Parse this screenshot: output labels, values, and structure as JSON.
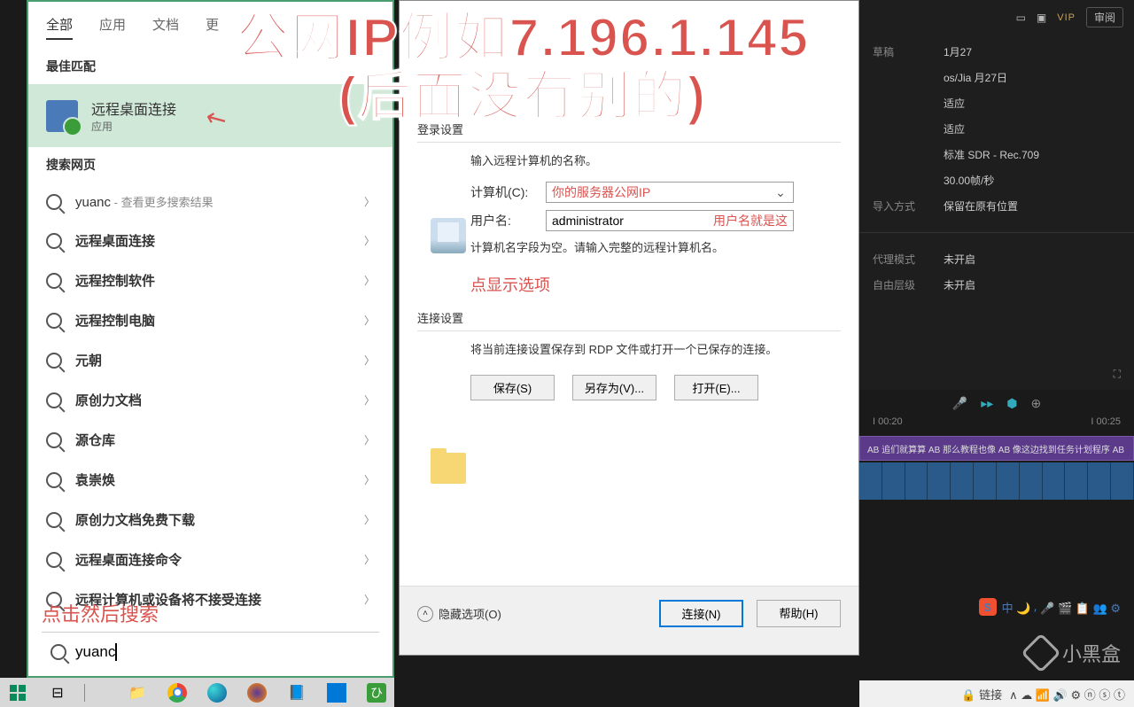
{
  "annotations": {
    "big": "公网IP例如7.196.1.145\n(后面没有别的)",
    "search_hint": "点击然后搜索",
    "arrow": "↖",
    "computer_field": "你的服务器公网IP",
    "username_note": "用户名就是这",
    "show_options": "点显示选项"
  },
  "search_panel": {
    "tabs": [
      "全部",
      "应用",
      "文档",
      "更"
    ],
    "best_match_header": "最佳匹配",
    "best_match": {
      "title": "远程桌面连接",
      "subtitle": "应用"
    },
    "web_header": "搜索网页",
    "items": [
      {
        "prefix": "yuanc",
        "suffix": " - 查看更多搜索结果",
        "bold": false
      },
      {
        "prefix": "远程桌面连接",
        "suffix": "",
        "bold": true
      },
      {
        "prefix": "远程控制软件",
        "suffix": "",
        "bold": true
      },
      {
        "prefix": "远程控制电脑",
        "suffix": "",
        "bold": true
      },
      {
        "prefix": "元朝",
        "suffix": "",
        "bold": true
      },
      {
        "prefix": "原创力文档",
        "suffix": "",
        "bold": true
      },
      {
        "prefix": "源仓库",
        "suffix": "",
        "bold": true
      },
      {
        "prefix": "袁崇焕",
        "suffix": "",
        "bold": true
      },
      {
        "prefix": "原创力文档免费下载",
        "suffix": "",
        "bold": true
      },
      {
        "prefix": "远程桌面连接命令",
        "suffix": "",
        "bold": true
      },
      {
        "prefix": "远程计算机或设备将不接受连接",
        "suffix": "",
        "bold": true
      }
    ],
    "query": "yuanc"
  },
  "rdp": {
    "login_header": "登录设置",
    "prompt": "输入远程计算机的名称。",
    "computer_label": "计算机(C):",
    "username_label": "用户名:",
    "username_value": "administrator",
    "empty_note": "计算机名字段为空。请输入完整的远程计算机名。",
    "conn_header": "连接设置",
    "conn_desc": "将当前连接设置保存到 RDP 文件或打开一个已保存的连接。",
    "save": "保存(S)",
    "save_as": "另存为(V)...",
    "open": "打开(E)...",
    "hide": "隐藏选项(O)",
    "connect": "连接(N)",
    "help": "帮助(H)"
  },
  "editor": {
    "vip": "VIP",
    "review": "审阅",
    "rows": [
      {
        "k": "草稿",
        "v": "1月27"
      },
      {
        "k": "",
        "v": "os/Jia    月27日"
      },
      {
        "k": "",
        "v": "适应"
      },
      {
        "k": "",
        "v": "适应"
      },
      {
        "k": "",
        "v": "标准 SDR - Rec.709"
      },
      {
        "k": "",
        "v": "30.00帧/秒"
      },
      {
        "k": "导入方式",
        "v": "保留在原有位置"
      }
    ],
    "rows2": [
      {
        "k": "代理模式",
        "v": "未开启"
      },
      {
        "k": "自由层级",
        "v": "未开启"
      }
    ],
    "timeline": {
      "t1": "I 00:20",
      "t2": "I 00:25"
    },
    "tracks": [
      "AB 追们就算算  AB 那么教程也像  AB 像这边找到任务计划程序       AB"
    ]
  },
  "ime": {
    "logo": "S",
    "chars": "中 🌙 ⸴ 🎤 🎬 📋 👥 ⚙"
  },
  "watermark": "小黑盒",
  "taskbar_right": {
    "lock": "🔒 链接",
    "icons": "∧ ☁ 📶 🔊 ⚙ ⓝ ⓢ ⓣ"
  }
}
